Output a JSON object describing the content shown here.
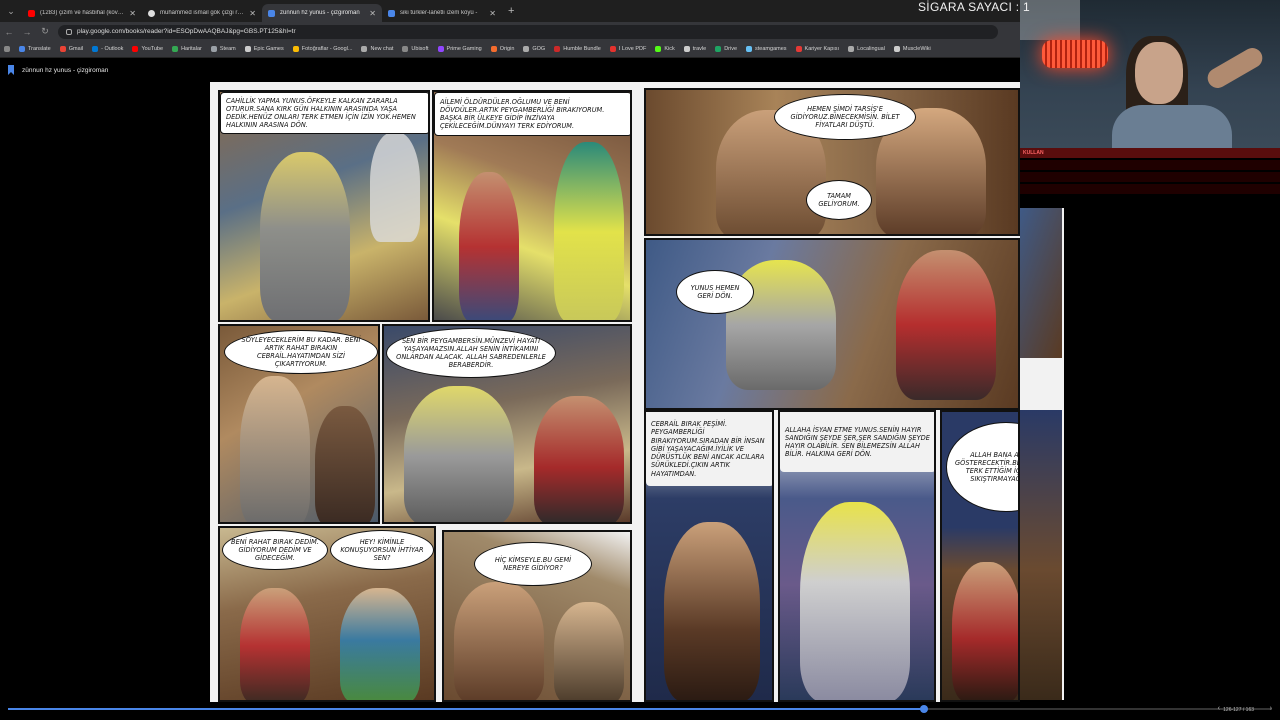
{
  "browser": {
    "tabs": [
      {
        "title": "(1283) çizim ve hasbihal (kovul...",
        "favicon_color": "#ff0000",
        "active": false
      },
      {
        "title": "muhammed ismail gök çizgi ro...",
        "favicon_color": "#dddddd",
        "active": false
      },
      {
        "title": "zünnun hz yunus - çizgiroman",
        "favicon_color": "#4a86e8",
        "active": true
      },
      {
        "title": "siki türkler-lanetli ızem köyü -",
        "favicon_color": "#4a86e8",
        "active": false
      }
    ],
    "url": "play.google.com/books/reader?id=ESOpDwAAQBAJ&pg=GBS.PT125&hl=tr",
    "bookmarks": [
      {
        "label": "Translate",
        "color": "#4a86e8"
      },
      {
        "label": "Gmail",
        "color": "#ea4335"
      },
      {
        "label": "- Outlook",
        "color": "#0078d4"
      },
      {
        "label": "YouTube",
        "color": "#ff0000"
      },
      {
        "label": "Haritalar",
        "color": "#34a853"
      },
      {
        "label": "Steam",
        "color": "#9aa0a6"
      },
      {
        "label": "Epic Games",
        "color": "#cccccc"
      },
      {
        "label": "Fotoğraflar - Googl...",
        "color": "#fbbc04"
      },
      {
        "label": "New chat",
        "color": "#aaaaaa"
      },
      {
        "label": "Ubisoft",
        "color": "#888888"
      },
      {
        "label": "Prime Gaming",
        "color": "#9146ff"
      },
      {
        "label": "Origin",
        "color": "#f56c2d"
      },
      {
        "label": "GOG",
        "color": "#aaaaaa"
      },
      {
        "label": "Humble Bundle",
        "color": "#cc2929"
      },
      {
        "label": "I Love PDF",
        "color": "#e5322d"
      },
      {
        "label": "Kick",
        "color": "#53fc18"
      },
      {
        "label": "travle",
        "color": "#cccccc"
      },
      {
        "label": "Drive",
        "color": "#1fa463"
      },
      {
        "label": "steamgames",
        "color": "#66c0f4"
      },
      {
        "label": "Kariyer Kapısı",
        "color": "#e53935"
      },
      {
        "label": "Localingual",
        "color": "#aaaaaa"
      },
      {
        "label": "MuscleWiki",
        "color": "#cccccc"
      }
    ]
  },
  "book": {
    "title": "zünnun hz yunus - çizgiroman",
    "page_indicator": "126-127 / 163",
    "progress_fraction": 0.725
  },
  "overlay": {
    "title": "SİGARA SAYACI : 1",
    "chat_header": "KULLAN"
  },
  "comic": {
    "bubbles": {
      "p1": "CAHİLLİK YAPMA YUNUS.ÖFKEYLE KALKAN ZARARLA OTURUR.SANA KIRK GÜN HALKININ ARASINDA YAŞA DEDİK.HENÜZ ONLARI TERK ETMEN İÇİN İZİN YOK.HEMEN HALKININ ARASINA DÖN.",
      "p2": "AİLEMİ ÖLDÜRDÜLER.OĞLUMU VE BENİ DÖVDÜLER.ARTIK PEYGAMBERLİĞİ BIRAKIYORUM. BAŞKA BİR ÜLKEYE GİDİP İNZİVAYA ÇEKİLECEĞİM.DÜNYAYI TERK EDİYORUM.",
      "p3a": "HEMEN ŞİMDİ TARSİŞ'E GİDİYORUZ.BİNECEKMİSİN. BİLET FİYATLARI DÜŞTÜ.",
      "p3b": "TAMAM GELİYORUM.",
      "p4": "YUNUS HEMEN GERİ DÖN.",
      "p5": "SÖYLEYECEKLERİM BU KADAR. BENİ ARTIK RAHAT BIRAKIN CEBRAİL.HAYATIMDAN SİZİ ÇIKARTIYORUM.",
      "p6": "SEN BİR PEYGAMBERSİN.MÜNZEVİ HAYATI YAŞAYAMAZSIN.ALLAH SENİN İNTİKAMINI ONLARDAN ALACAK. ALLAH SABREDENLERLE BERABERDİR.",
      "p7": "CEBRAİL BIRAK PEŞİMİ. PEYGAMBERLİĞİ BIRAKIYORUM.SIRADAN BİR İNSAN GİBİ YAŞAYACAĞIM.İYİLİK VE DÜRÜSTLÜK BENİ ANCAK ACILARA SÜRÜKLEDİ.ÇIKIN ARTIK HAYATIMDAN.",
      "p8": "ALLAHA İSYAN ETME YUNUS.SENİN HAYIR SANDIĞIN ŞEYDE ŞER,ŞER SANDIĞIN ŞEYDE HAYIR OLABİLİR. SEN BİLEMEZSİN ALLAH BİLİR. HALKINA GERİ DÖN.",
      "p9": "ALLAH BANA ANLAYIŞ GÖSTERECEKTİR.BENİ HALKIMI TERK ETTİĞİM İÇİN ASLA SIKIŞTIRMAYACAKTIR.",
      "p10a": "BENİ RAHAT BIRAK DEDİM. GİDİYORUM DEDİM VE GİDECEĞİM.",
      "p10b": "HEY! KİMİNLE KONUŞUYORSUN İHTİYAR SEN?",
      "p11": "HİÇ KİMSEYLE.BU GEMİ NEREYE GİDİYOR?"
    }
  }
}
